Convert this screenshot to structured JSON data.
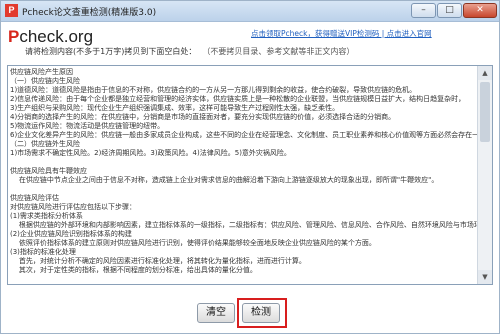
{
  "window": {
    "title": "Pcheck论文查重检测(精准版3.0)",
    "controls": {
      "minimize": "–",
      "maximize": "□",
      "close": "✕"
    }
  },
  "header": {
    "logo_p": "P",
    "logo_rest": "check.org",
    "links": "点击领取Pcheck，获得赠送VIP检测码 | 点击进入官网"
  },
  "instructions": {
    "text": "请将检测内容(不多于1万字)拷贝到下面空白处：",
    "note": "（不要拷贝目录、参考文献等非正文内容）"
  },
  "content_lines": [
    "供应链风险产生原因",
    "（一）供应链内生风险",
    "1)道德风险：道德风险是指由于信息的不对称，供应链合约的一方从另一方那儿得到剩余的收益，使合约破裂，导致供应链的危机。",
    "2)信息传递风险：由于每个企业都是独立经营和管理的经济实体，供应链实质上是一种松散的企业联盟，当供应链规模日益扩大，结构日趋复杂时，",
    "3)生产组织与采购风险：现代企业生产组织强调集成、效率，这样可能导致生产过程刚性太强，缺乏柔性。",
    "4)分销商的选择产生的风险：在供应链中，分销商是市场的直接面对者，要充分实现供应链的价值，必须选择合适的分销商。",
    "5)物流运作风险：物流活动是供应链管理的纽带。",
    "6)企业文化差异产生的风险：供应链一般由多家成员企业构成，这些不同的企业在经营理念、文化制度、员工职业素养和核心价值观等方面必然会存在一定的差异。",
    "（二）供应链外生风险",
    "1)市场需求不确定性风险。2)经济周期风险。3)政策风险。4)法律风险。5)意外灾祸风险。",
    "",
    "供应链风险具有牛鞭效应",
    "    在供应链中节点企业之间由于信息不对称，造成链上企业对需求信息的曲解沿着下游向上游链逐级放大的现象出现，即所谓\"牛鞭效应\"。",
    "",
    "供应链风险评估",
    "对供应链风险进行评估应包括以下步骤：",
    "(1)需求类指标分析体系",
    "    根据供应链的外部环境和内部影响因素，建立指标体系的一级指标，二级指标有：供应风险、管理风险、信息风险、合作风险、自然环境风险与市场环境风险等。",
    "(2)企业供应链风险识别指标体系的构建",
    "    依照评价指标体系的建立原则对供应链风险进行识别，使得评价结果能够较全面地反映企业供应链风险的某个方面。",
    "(3)指标的标准化处理",
    "    首先，对统计分析不确定的风险因素进行标准化处理，将其转化为量化指标，进而进行计算。",
    "    其次，对于定性类的指标，根据不同程度的划分标准，给出具体的量化分值。"
  ],
  "buttons": {
    "clear": "清空",
    "check": "检测"
  },
  "colors": {
    "accent_red": "#d81e1e",
    "link_blue": "#1f5fbf"
  }
}
